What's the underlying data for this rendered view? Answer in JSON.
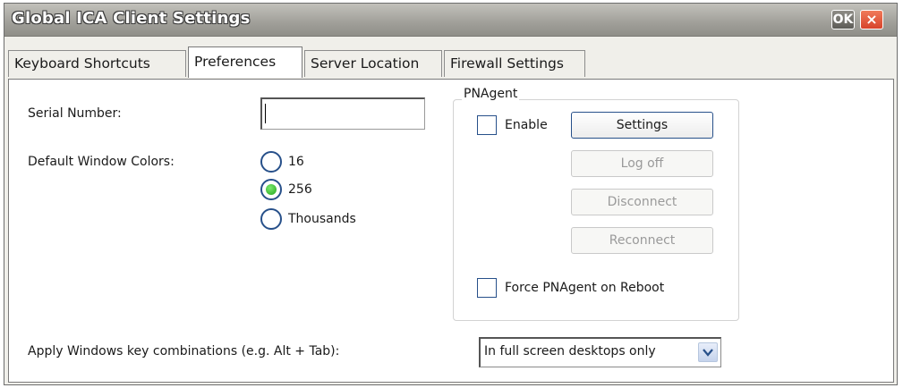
{
  "window": {
    "title": "Global ICA Client Settings",
    "ok_label": "OK",
    "close_glyph": "×"
  },
  "tabs": [
    {
      "label": "Keyboard Shortcuts",
      "active": false
    },
    {
      "label": "Preferences",
      "active": true
    },
    {
      "label": "Server Location",
      "active": false
    },
    {
      "label": "Firewall Settings",
      "active": false
    }
  ],
  "preferences": {
    "serial_number": {
      "label": "Serial Number:",
      "value": ""
    },
    "window_colors": {
      "label": "Default Window Colors:",
      "options": [
        "16",
        "256",
        "Thousands"
      ],
      "selected": "256"
    },
    "pnagent": {
      "group_label": "PNAgent",
      "enable_label": "Enable",
      "enable_checked": false,
      "buttons": [
        {
          "label": "Settings",
          "enabled": true
        },
        {
          "label": "Log off",
          "enabled": false
        },
        {
          "label": "Disconnect",
          "enabled": false
        },
        {
          "label": "Reconnect",
          "enabled": false
        }
      ],
      "force_label": "Force PNAgent on Reboot",
      "force_checked": false
    },
    "key_combinations": {
      "label": "Apply Windows key combinations (e.g. Alt + Tab):",
      "selected_value": "In full screen desktops only"
    }
  },
  "icons": {
    "ok": "ok-icon",
    "close": "close-icon",
    "dropdown": "chevron-down-icon"
  },
  "colors": {
    "accent": "#27508a",
    "radio_selected": "#22a51d",
    "close_button": "#d7432b"
  }
}
